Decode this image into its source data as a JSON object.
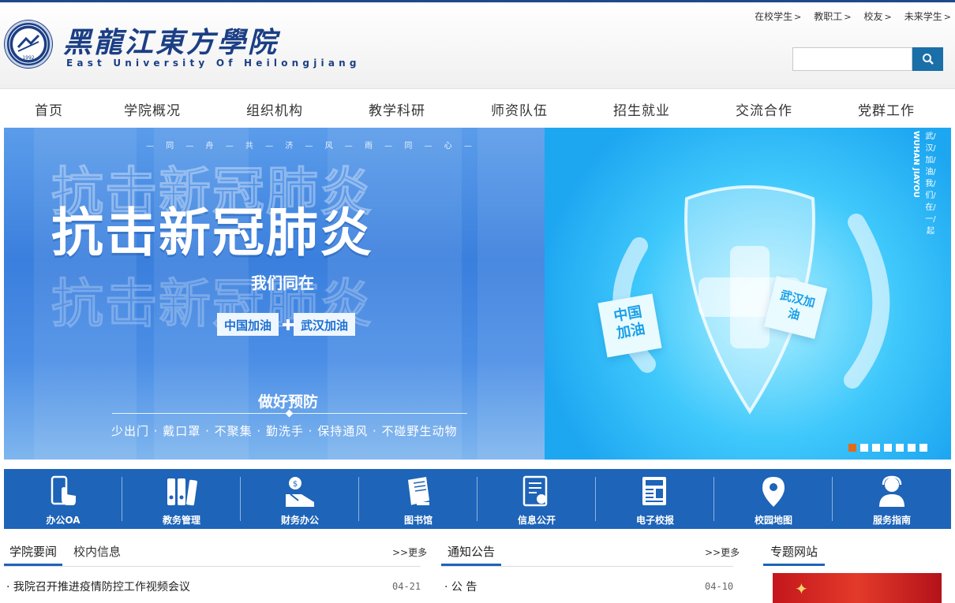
{
  "header": {
    "school_name_cn": "黑龍江東方學院",
    "school_name_en": "East  University  Of  Heilongjiang",
    "seal_year": "1992",
    "quick_links": [
      "在校学生",
      "教职工",
      "校友",
      "未来学生"
    ],
    "search": {
      "placeholder": "",
      "value": ""
    }
  },
  "nav": [
    "首页",
    "学院概况",
    "组织机构",
    "教学科研",
    "师资队伍",
    "招生就业",
    "交流合作",
    "党群工作"
  ],
  "banner": {
    "slogan_top": "— 同 — 舟 — 共 — 济 — 风 — 雨 — 同 — 心 —",
    "headline": "抗击新冠肺炎",
    "subheadline": "我们同在",
    "tag_left": "中国加油",
    "tag_right": "武汉加油",
    "prevention_title": "做好预防",
    "prevention_tips": "少出门 · 戴口罩 · 不聚集 · 勤洗手 · 保持通风 · 不碰野生动物",
    "card_china": "中国加油",
    "card_wuhan": "武汉加油",
    "vertical_cn": "武/汉/加/油/我/们/在/一/起",
    "vertical_en": "WUHAN JIAYOU",
    "slide_count": 7,
    "active_slide": 1
  },
  "services": [
    {
      "label": "办公OA",
      "icon": "phone-touch-icon"
    },
    {
      "label": "教务管理",
      "icon": "binders-icon"
    },
    {
      "label": "财务办公",
      "icon": "money-hand-icon"
    },
    {
      "label": "图书馆",
      "icon": "book-icon"
    },
    {
      "label": "信息公开",
      "icon": "document-icon"
    },
    {
      "label": "电子校报",
      "icon": "newspaper-icon"
    },
    {
      "label": "校园地图",
      "icon": "map-pin-icon"
    },
    {
      "label": "服务指南",
      "icon": "support-agent-icon"
    }
  ],
  "news": {
    "tabs": [
      "学院要闻",
      "校内信息"
    ],
    "more": "更多",
    "items": [
      {
        "title": "我院召开推进疫情防控工作视频会议",
        "date": "04-21"
      }
    ]
  },
  "notices": {
    "title": "通知公告",
    "more": "更多",
    "items": [
      {
        "title": "公  告",
        "date": "04-10"
      }
    ]
  },
  "topics": {
    "title": "专题网站"
  },
  "colors": {
    "brand": "#1b3f85",
    "service_bar": "#1e64b8",
    "accent": "#e36a1b",
    "search_button": "#1a6fa8"
  }
}
